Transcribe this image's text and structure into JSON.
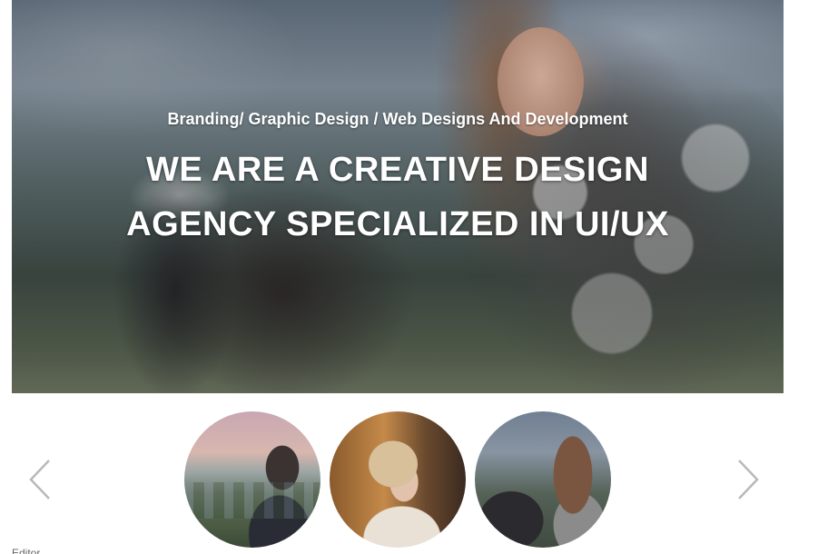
{
  "hero": {
    "subtitle": "Branding/ Graphic Design / Web Designs And Development",
    "title_line1": "WE ARE A CREATIVE DESIGN",
    "title_line2": "AGENCY SPECIALIZED IN UI/UX"
  },
  "carousel": {
    "prev_icon": "chevron-left-icon",
    "next_icon": "chevron-right-icon",
    "arrow_color": "#b9b9b9"
  },
  "footer_cut_text": "Editor"
}
